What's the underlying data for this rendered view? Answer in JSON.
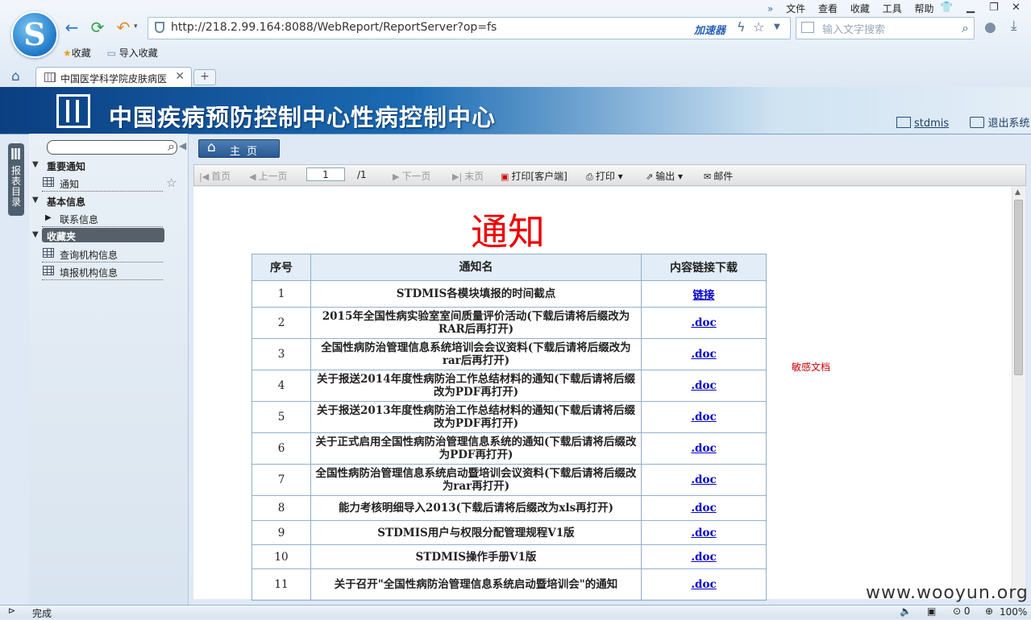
{
  "browser": {
    "menu": [
      "文件",
      "查看",
      "收藏",
      "工具",
      "帮助"
    ],
    "address": "http://218.2.99.164:8088/WebReport/ReportServer?op=fs",
    "accelerator": "加速器",
    "search_placeholder": "输入文字搜索",
    "favorites": [
      "收藏",
      "导入收藏"
    ],
    "tab_title": "中国医学科学院皮肤病医",
    "status": "完成",
    "zoom": "100%"
  },
  "app": {
    "title": "中国疾病预防控制中心性病控制中心",
    "user": "stdmis",
    "logout": "退出系统",
    "home_label": "主页"
  },
  "sidebar": {
    "vertical_tab": "报表目录",
    "groups": [
      {
        "label": "重要通知",
        "items": [
          "通知"
        ]
      },
      {
        "label": "基本信息",
        "items": [
          "联系信息"
        ]
      }
    ],
    "favorites_label": "收藏夹",
    "favorites_items": [
      "查询机构信息",
      "填报机构信息"
    ]
  },
  "toolbar": {
    "first": "首页",
    "prev": "上一页",
    "page_value": "1",
    "total": "/1",
    "next": "下一页",
    "last": "末页",
    "print_client": "打印[客户端]",
    "print": "打印",
    "export": "输出",
    "mail": "邮件"
  },
  "report": {
    "title": "通知",
    "note": "敏感文档",
    "columns": [
      "序号",
      "通知名",
      "内容链接下载"
    ],
    "rows": [
      {
        "no": "1",
        "name": "STDMIS各模块填报的时间截点",
        "link": "链接"
      },
      {
        "no": "2",
        "name": "2015年全国性病实验室室间质量评价活动(下载后请将后缀改为RAR后再打开)",
        "link": ".doc"
      },
      {
        "no": "3",
        "name": "全国性病防治管理信息系统培训会会议资料(下载后请将后缀改为rar后再打开)",
        "link": ".doc"
      },
      {
        "no": "4",
        "name": "关于报送2014年度性病防治工作总结材料的通知(下载后请将后缀改为PDF再打开)",
        "link": ".doc"
      },
      {
        "no": "5",
        "name": "关于报送2013年度性病防治工作总结材料的通知(下载后请将后缀改为PDF再打开)",
        "link": ".doc"
      },
      {
        "no": "6",
        "name": "关于正式启用全国性病防治管理信息系统的通知(下载后请将后缀改为PDF再打开)",
        "link": ".doc"
      },
      {
        "no": "7",
        "name": "全国性病防治管理信息系统启动暨培训会议资料(下载后请将后缀改为rar再打开)",
        "link": ".doc"
      },
      {
        "no": "8",
        "name": "能力考核明细导入2013(下载后请将后缀改为xls再打开)",
        "link": ".doc"
      },
      {
        "no": "9",
        "name": "STDMIS用户与权限分配管理规程V1版",
        "link": ".doc"
      },
      {
        "no": "10",
        "name": "STDMIS操作手册V1版",
        "link": ".doc"
      },
      {
        "no": "11",
        "name": "关于召开\"全国性病防治管理信息系统启动暨培训会\"的通知",
        "link": ".doc"
      }
    ]
  },
  "watermark": "www.wooyun.org"
}
